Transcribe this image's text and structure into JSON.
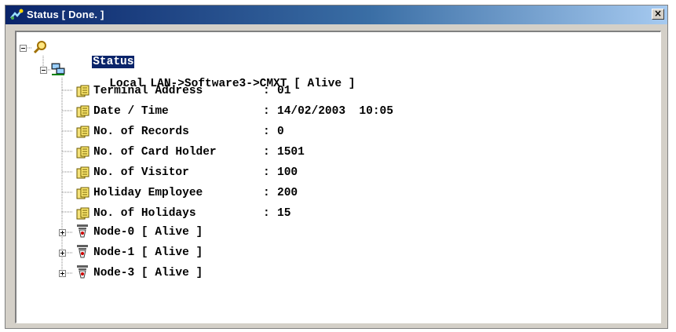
{
  "window": {
    "title": "Status [ Done. ]",
    "close_label": "×"
  },
  "tree": {
    "root": {
      "label": "Status"
    },
    "device": {
      "label": "Local LAN->Software3->CMXT [ Alive ]"
    },
    "fields": [
      {
        "name": "Terminal Address",
        "value": "01"
      },
      {
        "name": "Date / Time",
        "value": "14/02/2003  10:05"
      },
      {
        "name": "No. of Records",
        "value": "0"
      },
      {
        "name": "No. of Card Holder",
        "value": "1501"
      },
      {
        "name": "No. of Visitor",
        "value": "100"
      },
      {
        "name": "Holiday Employee",
        "value": "200"
      },
      {
        "name": "No. of Holidays",
        "value": "15"
      }
    ],
    "separator": ":",
    "nodes": [
      {
        "label": "Node-0 [ Alive ]"
      },
      {
        "label": "Node-1 [ Alive ]"
      },
      {
        "label": "Node-3 [ Alive ]"
      }
    ]
  },
  "colors": {
    "titlebar_start": "#0a246a",
    "titlebar_end": "#a6caf0",
    "selection": "#0a246a",
    "window_face": "#d4d0c8"
  },
  "icons": {
    "title": "status-app-icon",
    "root": "magnifier-icon",
    "device": "network-computer-icon",
    "field": "document-icon",
    "node": "door-reader-icon"
  }
}
